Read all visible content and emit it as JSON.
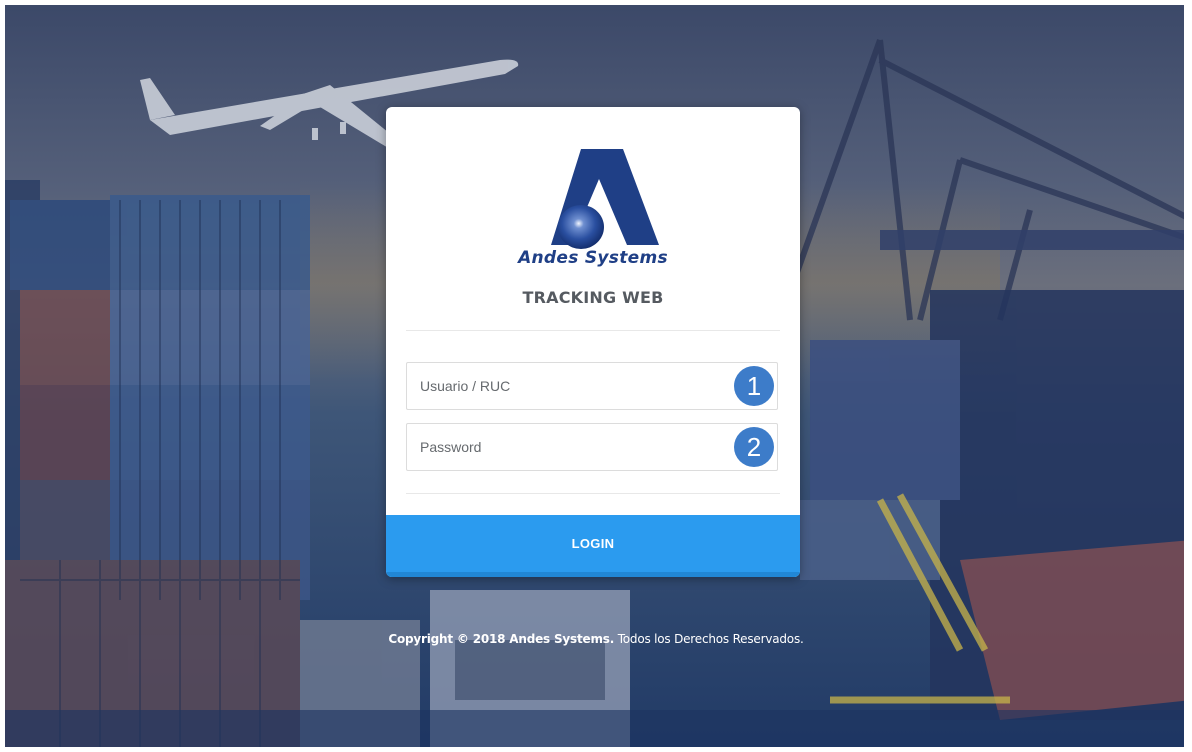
{
  "brand": {
    "name": "Andes Systems",
    "app_title": "TRACKING WEB",
    "logo_colors": {
      "triangle": "#1f3f86",
      "sphere": "#2a4fa0"
    }
  },
  "form": {
    "username": {
      "placeholder": "Usuario / RUC",
      "marker": "1"
    },
    "password": {
      "placeholder": "Password",
      "marker": "2"
    },
    "login_label": "LOGIN"
  },
  "footer": {
    "prefix": "Copyright © 2018",
    "company": "Andes Systems.",
    "suffix": "Todos los Derechos Reservados."
  },
  "colors": {
    "accent": "#2b9bef",
    "marker": "#3d7cc9",
    "title_text": "#555a60",
    "brand_text": "#1f3f86"
  }
}
